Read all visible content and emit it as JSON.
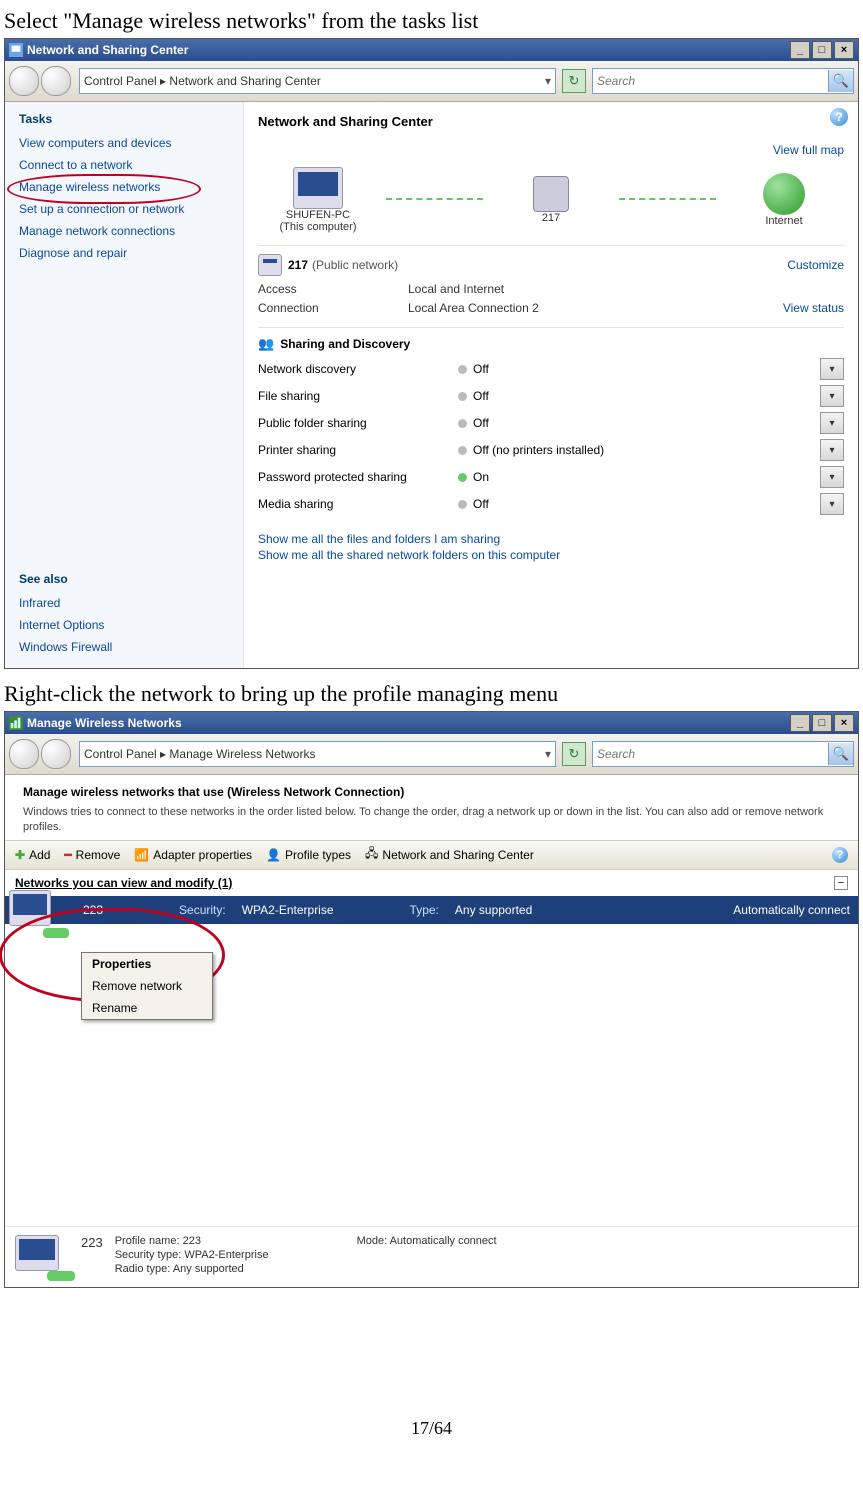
{
  "page": {
    "instr1": "Select \"Manage wireless networks\" from the tasks list",
    "instr2": "Right-click the network to bring up the profile managing menu",
    "pagenum": "17/64"
  },
  "win1": {
    "title": "Network and Sharing Center",
    "breadcrumb": "Control Panel  ▸  Network and Sharing Center",
    "search_placeholder": "Search",
    "sidebar": {
      "tasks_hdr": "Tasks",
      "items": [
        "View computers and devices",
        "Connect to a network",
        "Manage wireless networks",
        "Set up a connection or network",
        "Manage network connections",
        "Diagnose and repair"
      ],
      "seealso_hdr": "See also",
      "seealso": [
        "Infrared",
        "Internet Options",
        "Windows Firewall"
      ]
    },
    "main": {
      "heading": "Network and Sharing Center",
      "viewfullmap": "View full map",
      "map": {
        "pc": "SHUFEN-PC",
        "pc_sub": "(This computer)",
        "mid": "217",
        "net": "Internet"
      },
      "net_label": "217",
      "net_type": "(Public network)",
      "customize": "Customize",
      "kv": [
        {
          "k": "Access",
          "v": "Local and Internet",
          "a": ""
        },
        {
          "k": "Connection",
          "v": "Local Area Connection 2",
          "a": "View status"
        }
      ],
      "sharing_hdr": "Sharing and Discovery",
      "sharing": [
        {
          "k": "Network discovery",
          "v": "Off",
          "on": false
        },
        {
          "k": "File sharing",
          "v": "Off",
          "on": false
        },
        {
          "k": "Public folder sharing",
          "v": "Off",
          "on": false
        },
        {
          "k": "Printer sharing",
          "v": "Off (no printers installed)",
          "on": false
        },
        {
          "k": "Password protected sharing",
          "v": "On",
          "on": true
        },
        {
          "k": "Media sharing",
          "v": "Off",
          "on": false
        }
      ],
      "links": [
        "Show me all the files and folders I am sharing",
        "Show me all the shared network folders on this computer"
      ]
    }
  },
  "win2": {
    "title": "Manage Wireless Networks",
    "breadcrumb": "Control Panel  ▸  Manage Wireless Networks",
    "search_placeholder": "Search",
    "heading": "Manage wireless networks that use (Wireless Network Connection)",
    "sub": "Windows tries to connect to these networks in the order listed below. To change the order, drag a network up or down in the list. You can also add or remove network profiles.",
    "toolbar": {
      "add": "Add",
      "remove": "Remove",
      "adapter": "Adapter properties",
      "profile": "Profile types",
      "nsc": "Network and Sharing Center"
    },
    "group": "Networks you can view and modify (1)",
    "row": {
      "name": "223",
      "sec_label": "Security:",
      "sec": "WPA2-Enterprise",
      "typ_label": "Type:",
      "typ": "Any supported",
      "auto": "Automatically connect"
    },
    "ctx": [
      "Properties",
      "Remove network",
      "Rename"
    ],
    "details": {
      "name": "223",
      "profile_k": "Profile name:",
      "profile_v": "223",
      "sec_k": "Security type:",
      "sec_v": "WPA2-Enterprise",
      "radio_k": "Radio type:",
      "radio_v": "Any supported",
      "mode_k": "Mode:",
      "mode_v": "Automatically connect"
    }
  }
}
